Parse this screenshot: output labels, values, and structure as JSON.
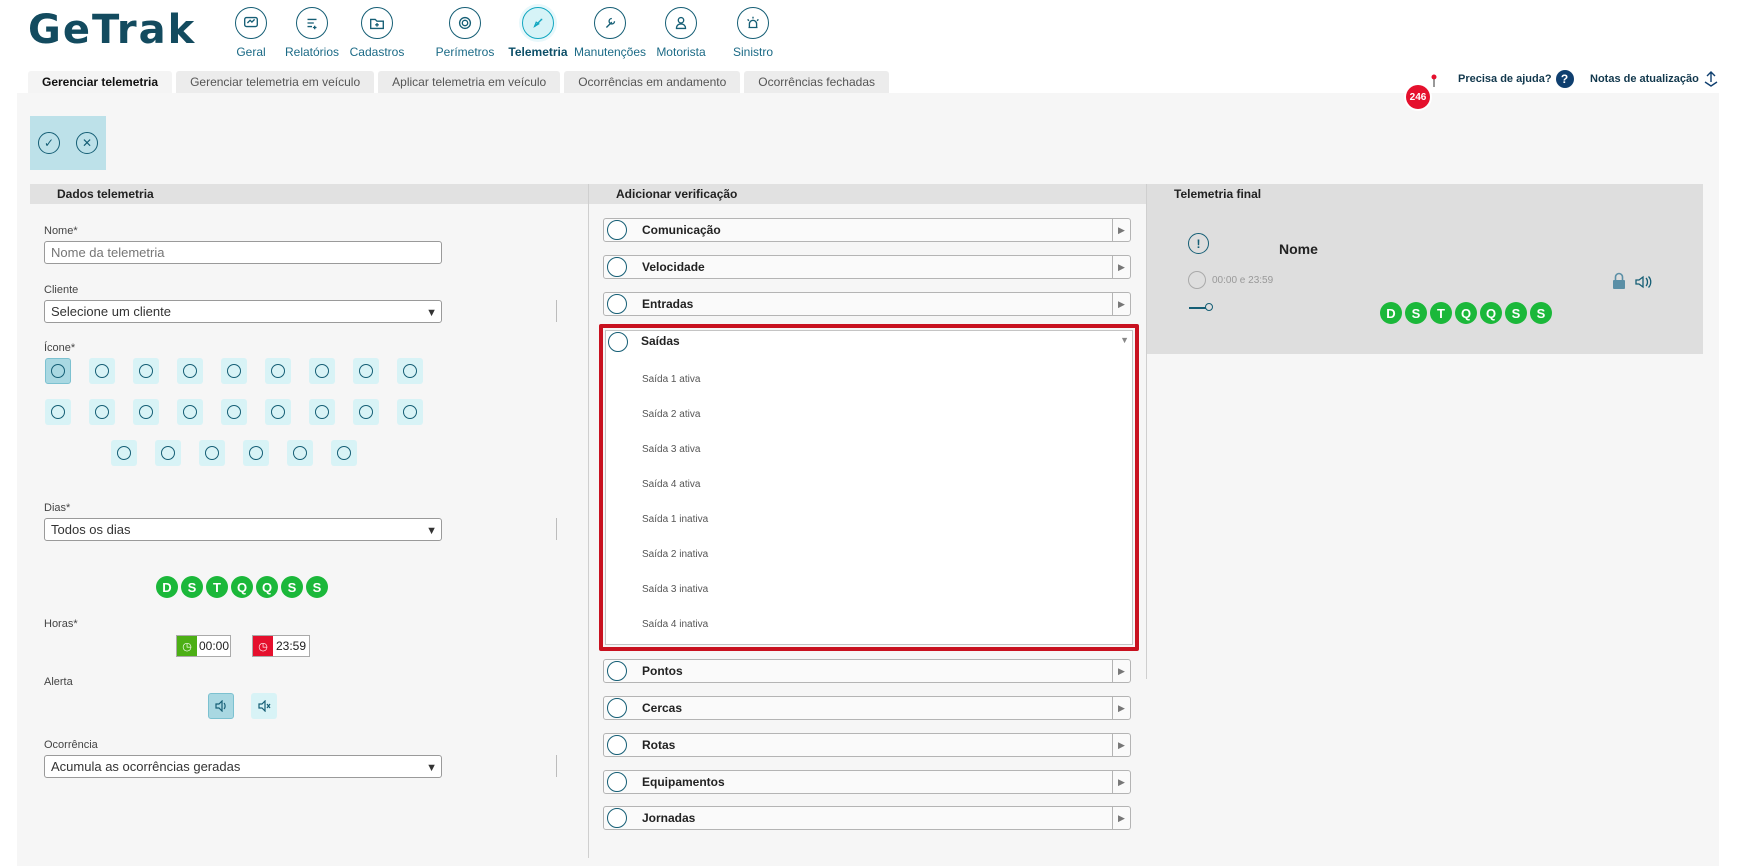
{
  "app": {
    "logo": "GeTrak"
  },
  "nav": [
    {
      "label": "Geral",
      "icon": "dashboard-icon"
    },
    {
      "label": "Relatórios",
      "icon": "reports-icon"
    },
    {
      "label": "Cadastros",
      "icon": "folder-add-icon"
    },
    {
      "label": "Perímetros",
      "icon": "perimeter-icon"
    },
    {
      "label": "Telemetria",
      "icon": "telemetry-icon",
      "active": true
    },
    {
      "label": "Manutenções",
      "icon": "wrench-icon"
    },
    {
      "label": "Motorista",
      "icon": "driver-icon"
    },
    {
      "label": "Sinistro",
      "icon": "siren-icon"
    }
  ],
  "tabs": [
    {
      "label": "Gerenciar telemetria",
      "active": true
    },
    {
      "label": "Gerenciar telemetria em veículo"
    },
    {
      "label": "Aplicar telemetria em veículo"
    },
    {
      "label": "Ocorrências em andamento"
    },
    {
      "label": "Ocorrências fechadas"
    }
  ],
  "header_right": {
    "notifications_count": "246",
    "help_label": "Precisa de ajuda?",
    "updates_label": "Notas de atualização"
  },
  "dados": {
    "title": "Dados telemetria",
    "nome_label": "Nome*",
    "nome_placeholder": "Nome da telemetria",
    "cliente_label": "Cliente",
    "cliente_value": "Selecione um cliente",
    "icone_label": "Ícone*",
    "dias_label": "Dias*",
    "dias_value": "Todos os dias",
    "days": [
      "D",
      "S",
      "T",
      "Q",
      "Q",
      "S",
      "S"
    ],
    "horas_label": "Horas*",
    "hora_inicio": "00:00",
    "hora_fim": "23:59",
    "alerta_label": "Alerta",
    "ocorrencia_label": "Ocorrência",
    "ocorrencia_value": "Acumula as ocorrências geradas"
  },
  "verificacao": {
    "title": "Adicionar verificação",
    "items": [
      "Comunicação",
      "Velocidade",
      "Entradas",
      "Saídas",
      "Pontos",
      "Cercas",
      "Rotas",
      "Equipamentos",
      "Jornadas"
    ],
    "expanded_item": "Saídas",
    "saidas_options": [
      "Saída 1 ativa",
      "Saída 2 ativa",
      "Saída 3 ativa",
      "Saída 4 ativa",
      "Saída 1 inativa",
      "Saída 2 inativa",
      "Saída 3 inativa",
      "Saída 4 inativa"
    ]
  },
  "final": {
    "title": "Telemetria final",
    "name": "Nome",
    "time_range": "00:00 e 23:59",
    "days": [
      "D",
      "S",
      "T",
      "Q",
      "Q",
      "S",
      "S"
    ]
  },
  "colors": {
    "primary": "#155e75",
    "accent": "#12a7c0",
    "day_green": "#1bb83a",
    "alert_red": "#c8111f",
    "badge_red": "#e5102d"
  }
}
